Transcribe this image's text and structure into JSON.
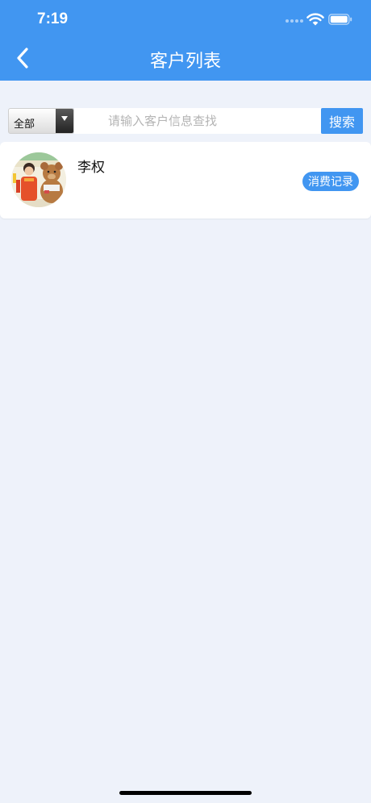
{
  "status_bar": {
    "time": "7:19"
  },
  "nav": {
    "title": "客户列表",
    "back_icon": "chevron-left-icon"
  },
  "search": {
    "filter_label": "全部",
    "placeholder": "请输入客户信息查找",
    "value": "",
    "button_label": "搜索"
  },
  "customers": [
    {
      "name": "李权",
      "records_label": "消费记录"
    }
  ],
  "colors": {
    "accent": "#4196f1",
    "background": "#eef2fa",
    "card": "#ffffff"
  }
}
